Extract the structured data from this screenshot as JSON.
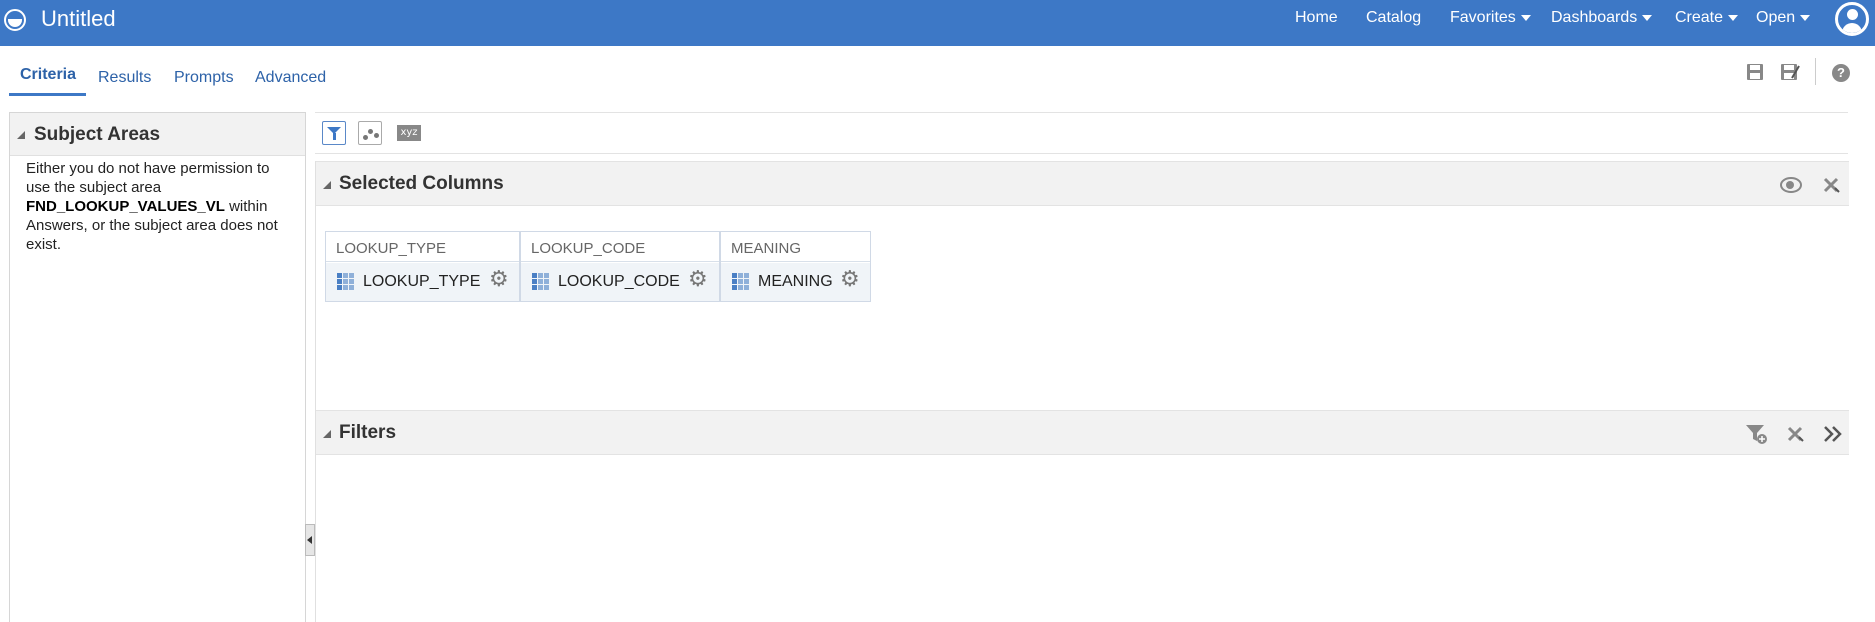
{
  "app": {
    "title": "Untitled"
  },
  "topnav": {
    "home": "Home",
    "catalog": "Catalog",
    "favorites": "Favorites",
    "dashboards": "Dashboards",
    "create": "Create",
    "open": "Open"
  },
  "tabs": [
    {
      "label": "Criteria",
      "active": true
    },
    {
      "label": "Results",
      "active": false
    },
    {
      "label": "Prompts",
      "active": false
    },
    {
      "label": "Advanced",
      "active": false
    }
  ],
  "left_panel": {
    "title": "Subject Areas",
    "message_prefix": "Either you do not have permission to use the subject area",
    "subject_area": "FND_LOOKUP_VALUES_VL",
    "message_suffix": "within Answers, or the subject area does not exist."
  },
  "toolbar": {
    "xyz_label": "xyz"
  },
  "selected_columns": {
    "title": "Selected Columns",
    "columns": [
      {
        "header": "LOOKUP_TYPE",
        "name": "LOOKUP_TYPE"
      },
      {
        "header": "LOOKUP_CODE",
        "name": "LOOKUP_CODE"
      },
      {
        "header": "MEANING",
        "name": "MEANING"
      }
    ]
  },
  "filters": {
    "title": "Filters"
  },
  "colors": {
    "brand_bar": "#3d78c6",
    "link": "#2d62a8"
  }
}
